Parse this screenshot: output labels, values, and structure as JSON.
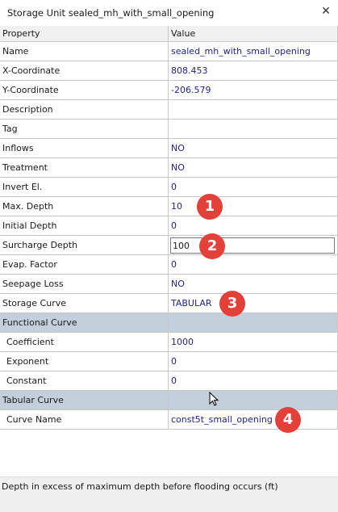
{
  "window": {
    "title": "Storage Unit sealed_mh_with_small_opening",
    "close_glyph": "✕"
  },
  "grid": {
    "columns": [
      "Property",
      "Value"
    ],
    "rows": [
      {
        "property": "Name",
        "value": "sealed_mh_with_small_opening"
      },
      {
        "property": "X-Coordinate",
        "value": "808.453"
      },
      {
        "property": "Y-Coordinate",
        "value": "-206.579"
      },
      {
        "property": "Description",
        "value": ""
      },
      {
        "property": "Tag",
        "value": ""
      },
      {
        "property": "Inflows",
        "value": "NO"
      },
      {
        "property": "Treatment",
        "value": "NO"
      },
      {
        "property": "Invert El.",
        "value": "0"
      },
      {
        "property": "Max. Depth",
        "value": "10"
      },
      {
        "property": "Initial Depth",
        "value": "0"
      },
      {
        "property": "Surcharge Depth",
        "value": "100"
      },
      {
        "property": "Evap. Factor",
        "value": "0"
      },
      {
        "property": "Seepage Loss",
        "value": "NO"
      },
      {
        "property": "Storage Curve",
        "value": "TABULAR"
      },
      {
        "property": "Functional Curve",
        "value": ""
      },
      {
        "property": "Coefficient",
        "value": "1000"
      },
      {
        "property": "Exponent",
        "value": "0"
      },
      {
        "property": "Constant",
        "value": "0"
      },
      {
        "property": "Tabular Curve",
        "value": ""
      },
      {
        "property": "Curve Name",
        "value": "const5t_small_opening"
      }
    ]
  },
  "badges": [
    "1",
    "2",
    "3",
    "4"
  ],
  "status_bar": {
    "text": "Depth in excess of maximum depth before flooding occurs (ft)"
  },
  "colors": {
    "value_text": "#1f1f8a",
    "category_row": "#c3cfdb",
    "badge": "#e3403a"
  }
}
